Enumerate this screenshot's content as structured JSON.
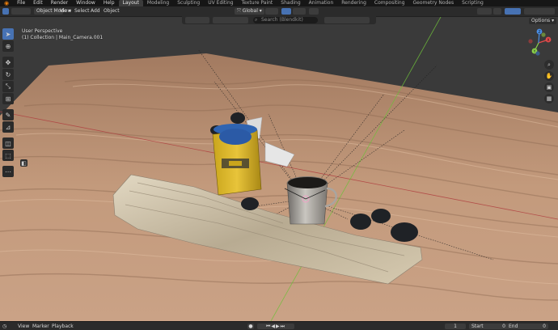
{
  "menubar": {
    "menus": [
      "File",
      "Edit",
      "Render",
      "Window",
      "Help"
    ],
    "workspaces": [
      "Layout",
      "Modeling",
      "Sculpting",
      "UV Editing",
      "Texture Paint",
      "Shading",
      "Animation",
      "Rendering",
      "Compositing",
      "Geometry Nodes",
      "Scripting"
    ],
    "active_workspace": "Layout"
  },
  "header": {
    "mode": "Object Mode",
    "menus": [
      "View",
      "Select",
      "Add",
      "Object"
    ],
    "orientation": "Global",
    "options_label": "Options"
  },
  "toolrow": {
    "search_placeholder": "Search (Blendkit)"
  },
  "viewport": {
    "view_name": "User Perspective",
    "collection_info": "(1) Collection | Main_Camera.001"
  },
  "gizmo": {
    "x": "X",
    "y": "Y",
    "z": "Z"
  },
  "timeline": {
    "menus": [
      "View",
      "Marker",
      "Playback"
    ],
    "current_frame": "1",
    "start_label": "Start",
    "start_value": "0",
    "end_label": "End",
    "end_value": "0"
  },
  "colors": {
    "accent": "#4772b3",
    "active_tab": "#3b3b3b",
    "axis_x": "#e54b4b",
    "axis_y": "#8bd14a",
    "axis_z": "#4a8ee5"
  }
}
